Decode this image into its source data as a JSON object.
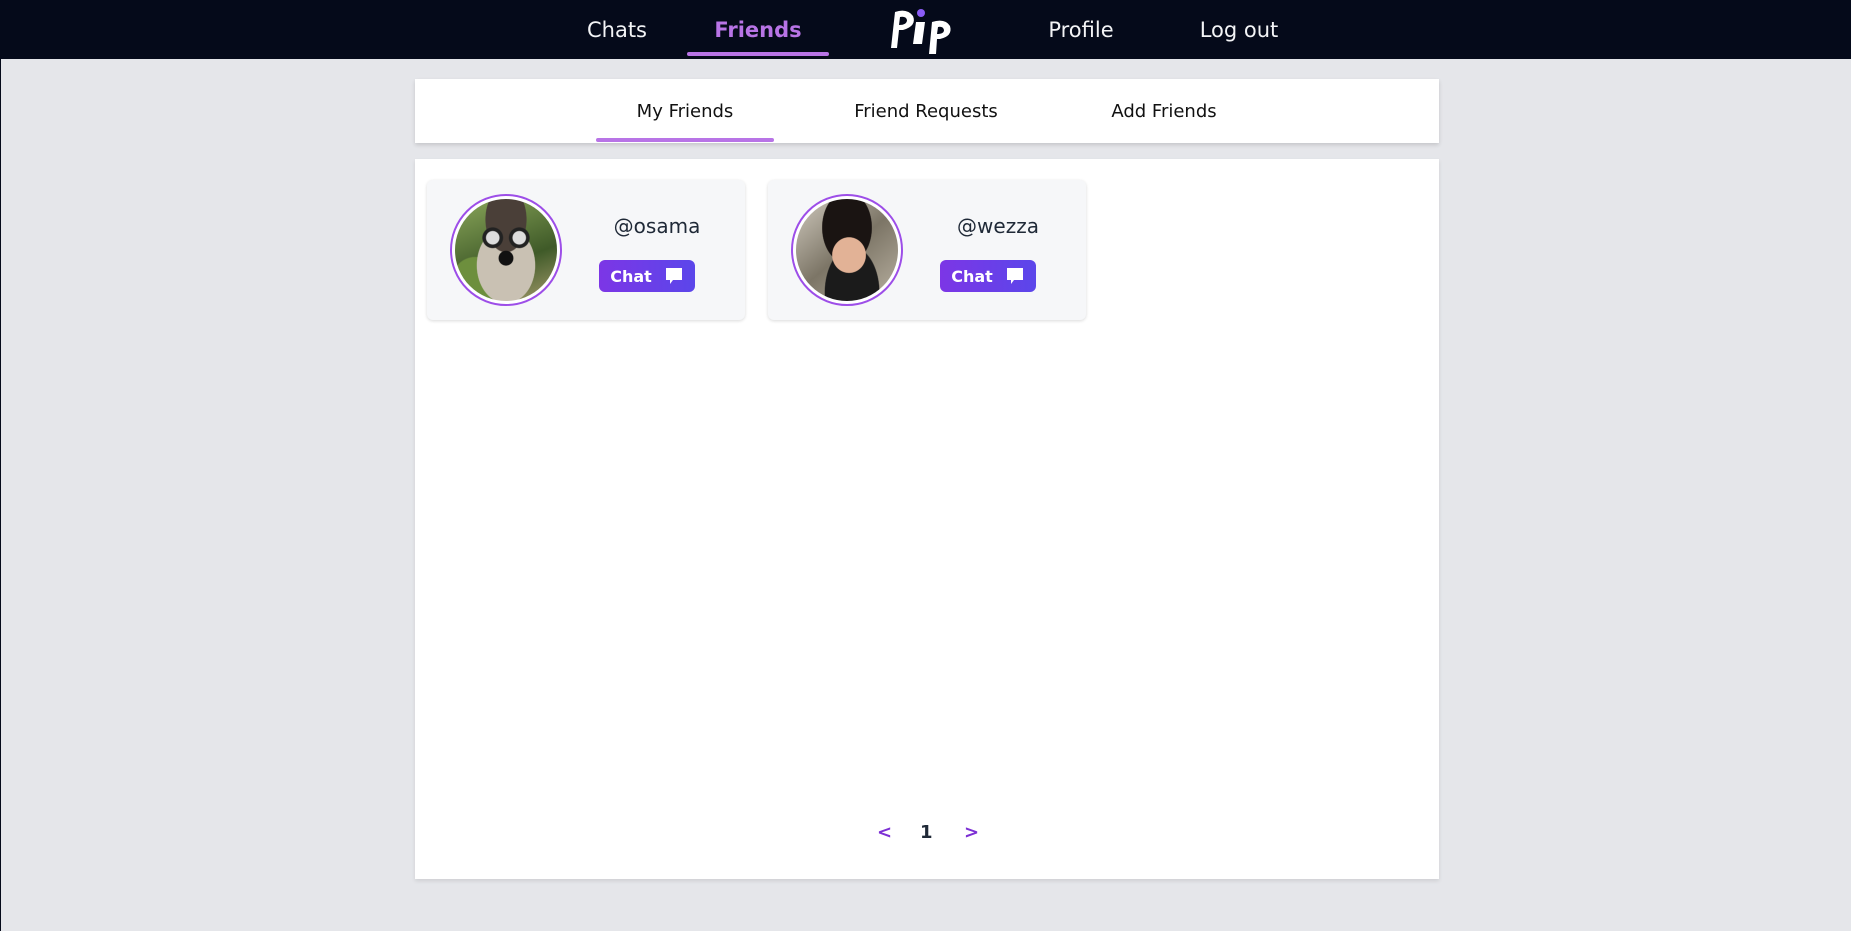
{
  "nav": {
    "items": [
      {
        "label": "Chats"
      },
      {
        "label": "Friends",
        "active": true
      },
      {
        "label": "Profile"
      },
      {
        "label": "Log out"
      }
    ],
    "logo_text": "Pip",
    "accent_color": "#b874e6"
  },
  "subtabs": {
    "items": [
      {
        "label": "My Friends",
        "active": true
      },
      {
        "label": "Friend Requests"
      },
      {
        "label": "Add Friends"
      }
    ]
  },
  "friends": [
    {
      "username": "@osama",
      "chat_label": "Chat",
      "avatar": "dog-with-cap-and-glasses"
    },
    {
      "username": "@wezza",
      "chat_label": "Chat",
      "avatar": "curly-haired-man-selfie"
    }
  ],
  "pagination": {
    "prev": "<",
    "current": "1",
    "next": ">"
  },
  "colors": {
    "nav_bg": "#050a1a",
    "page_bg": "#e5e6ea",
    "button_gradient_start": "#7c36e6",
    "button_gradient_end": "#5b46ea"
  }
}
